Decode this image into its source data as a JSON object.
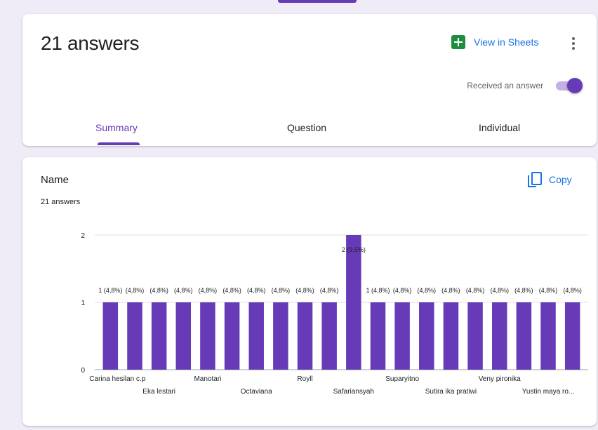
{
  "summary_header": {
    "title": "21 answers",
    "view_in_sheets_label": "View in Sheets",
    "accepting_label": "Received an answer",
    "accepting_enabled": true,
    "tabs": [
      {
        "label": "Summary",
        "active": true
      },
      {
        "label": "Question",
        "active": false
      },
      {
        "label": "Individual",
        "active": false
      }
    ]
  },
  "question": {
    "title": "Name",
    "response_count": "21 answers",
    "copy_label": "Copy"
  },
  "colors": {
    "accent": "#673ab7",
    "link": "#1a73e8",
    "sheets_green": "#1e8e3e",
    "background": "#efebf7"
  },
  "chart_data": {
    "type": "bar",
    "ylim": [
      0,
      2
    ],
    "yticks": [
      "0",
      "1",
      "2"
    ],
    "grid": true,
    "bar_color": "#673ab7",
    "values": [
      1,
      1,
      1,
      1,
      1,
      1,
      1,
      1,
      1,
      1,
      2,
      1,
      1,
      1,
      1,
      1,
      1,
      1,
      1,
      1
    ],
    "data_labels": [
      "1 (4,8%)",
      "(4,8%)",
      "(4,8%)",
      "(4,8%)",
      "(4,8%)",
      "(4,8%)",
      "(4,8%)",
      "(4,8%)",
      "(4,8%)",
      "(4,8%)",
      "2 (9,5%)",
      "1 (4,8%)",
      "(4,8%)",
      "(4,8%)",
      "(4,8%)",
      "(4,8%)",
      "(4,8%)",
      "(4,8%)",
      "(4,8%)",
      "(4,8%)"
    ],
    "category_labels": [
      "Carina hesilan c.p",
      "Eka lestari",
      "Manotari",
      "Octaviana",
      "Royll",
      "Safariansyah",
      "Suparyitno",
      "Sutira ika pratiwi",
      "Veny pironika",
      "Yustin maya ro..."
    ]
  }
}
